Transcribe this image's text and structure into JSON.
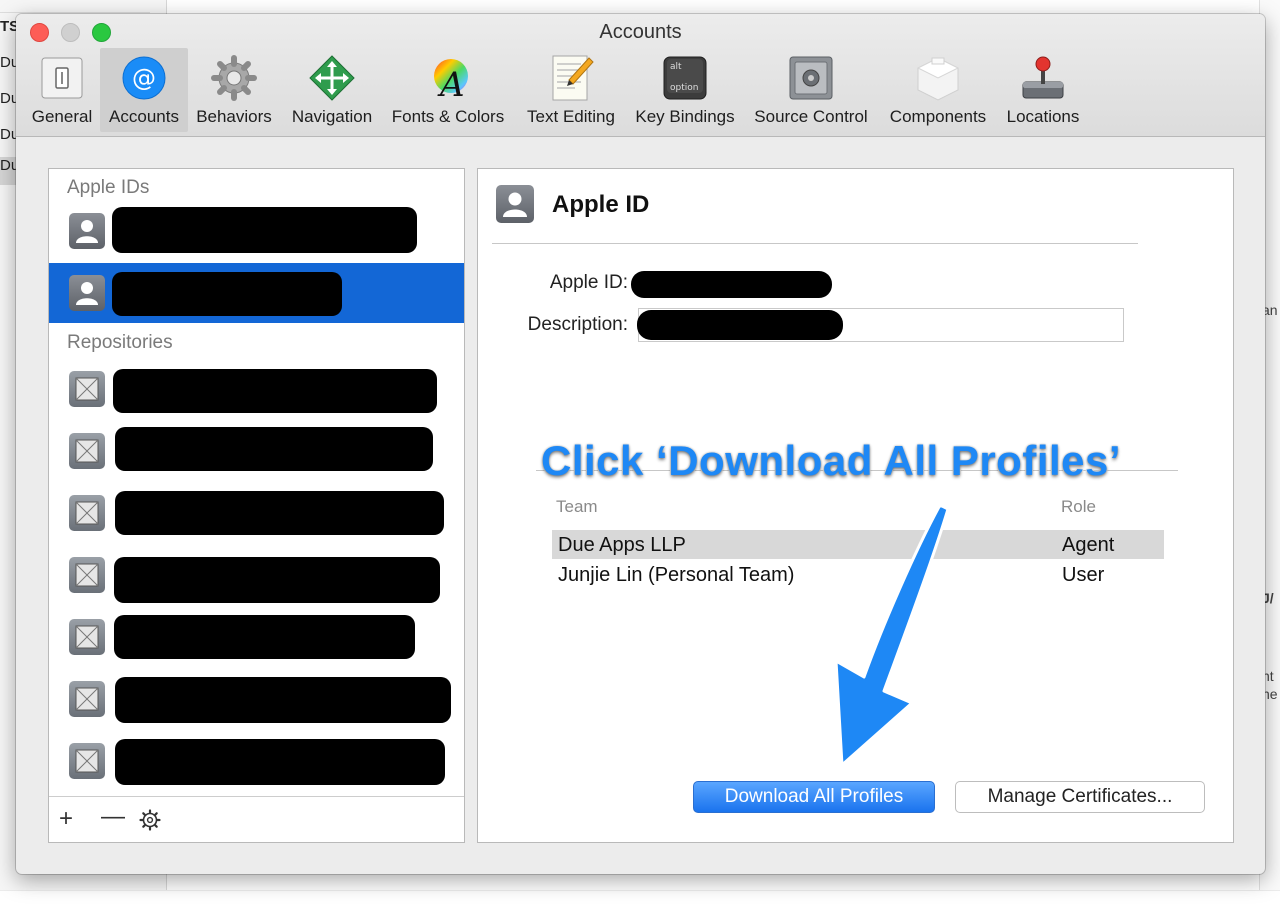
{
  "background": {
    "left_labels": [
      "TS",
      "Du",
      "Du",
      "Du",
      "Du"
    ],
    "right_labels": [
      "an",
      "J/",
      ":",
      "nt",
      "he"
    ]
  },
  "window": {
    "title": "Accounts",
    "toolbar": [
      {
        "label": "General",
        "icon": "general-icon"
      },
      {
        "label": "Accounts",
        "icon": "at-sign-icon",
        "selected": true
      },
      {
        "label": "Behaviors",
        "icon": "gear-icon"
      },
      {
        "label": "Navigation",
        "icon": "navigation-arrows-icon"
      },
      {
        "label": "Fonts & Colors",
        "icon": "fonts-colors-icon"
      },
      {
        "label": "Text Editing",
        "icon": "text-editing-icon"
      },
      {
        "label": "Key Bindings",
        "icon": "keyboard-key-icon",
        "key_text_top": "alt",
        "key_text_bottom": "option"
      },
      {
        "label": "Source Control",
        "icon": "safe-icon"
      },
      {
        "label": "Components",
        "icon": "components-icon"
      },
      {
        "label": "Locations",
        "icon": "joystick-icon"
      }
    ]
  },
  "left_panel": {
    "apple_ids_header": "Apple IDs",
    "repositories_header": "Repositories",
    "apple_ids_count": 2,
    "repositories_count": 7,
    "footer": {
      "add": "+",
      "remove": "—"
    }
  },
  "right_panel": {
    "title": "Apple ID",
    "apple_id_label": "Apple ID:",
    "description_label": "Description:",
    "annotation": "Click ‘Download All Profiles’",
    "columns": {
      "team": "Team",
      "role": "Role"
    },
    "teams": [
      {
        "team": "Due Apps LLP",
        "role": "Agent",
        "selected": true
      },
      {
        "team": "Junjie Lin (Personal Team)",
        "role": "User",
        "selected": false
      }
    ],
    "download_button": "Download All Profiles",
    "manage_button": "Manage Certificates..."
  },
  "colors": {
    "accent_blue": "#1367d6",
    "annotation_blue": "#1e88f5",
    "close": "#fd5d56",
    "zoom": "#2ac840"
  }
}
